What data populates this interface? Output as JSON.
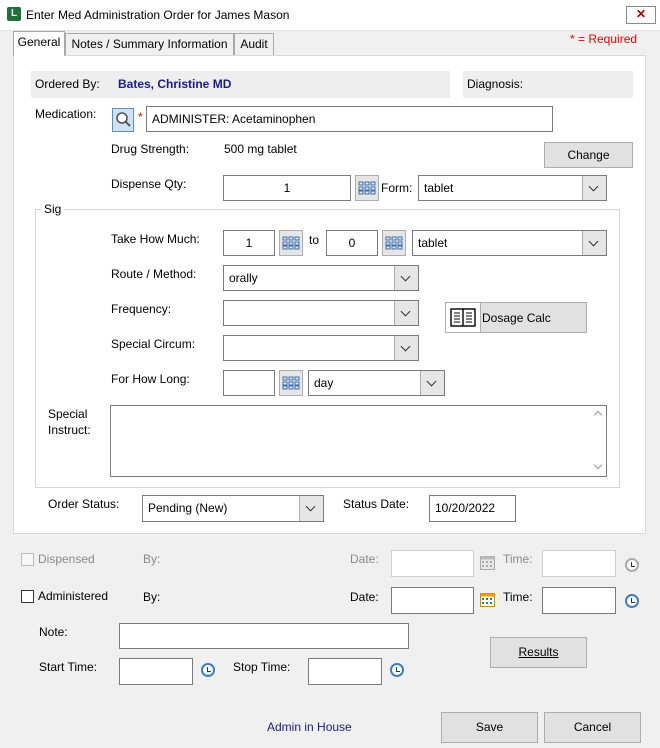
{
  "window": {
    "title": "Enter Med Administration Order for James Mason",
    "icon_letter": "L"
  },
  "tabs": [
    "General",
    "Notes / Summary Information",
    "Audit"
  ],
  "required_note": "* = Required",
  "header": {
    "ordered_by_label": "Ordered By:",
    "ordered_by_value": "Bates, Christine  MD",
    "diagnosis_label": "Diagnosis:"
  },
  "medication": {
    "label": "Medication:",
    "required_mark": "*",
    "value": "ADMINISTER: Acetaminophen",
    "strength_label": "Drug Strength:",
    "strength_value": "500 mg tablet",
    "change_button": "Change",
    "dispense_label": "Dispense Qty:",
    "dispense_value": "1",
    "form_label": "Form:",
    "form_value": "tablet"
  },
  "sig": {
    "group_label": "Sig",
    "take_label": "Take How Much:",
    "take_from": "1",
    "to_label": "to",
    "take_to": "0",
    "take_unit": "tablet",
    "route_label": "Route / Method:",
    "route_value": "orally",
    "frequency_label": "Frequency:",
    "frequency_value": "",
    "dosage_calc_button": "Dosage Calc",
    "special_circum_label": "Special Circum:",
    "special_circum_value": "",
    "how_long_label": "For How Long:",
    "how_long_value": "",
    "how_long_unit": "day",
    "special_instruct_label_1": "Special",
    "special_instruct_label_2": "Instruct:",
    "special_instruct_value": ""
  },
  "status": {
    "order_status_label": "Order Status:",
    "order_status_value": "Pending (New)",
    "status_date_label": "Status Date:",
    "status_date_value": "10/20/2022"
  },
  "dispensed": {
    "label": "Dispensed",
    "checked": false,
    "by_label": "By:",
    "date_label": "Date:",
    "time_label": "Time:"
  },
  "administered": {
    "label": "Administered",
    "checked": false,
    "by_label": "By:",
    "date_label": "Date:",
    "time_label": "Time:"
  },
  "note_label": "Note:",
  "start_time_label": "Start Time:",
  "stop_time_label": "Stop Time:",
  "results_button": "Results",
  "admin_link": "Admin in House",
  "save_button": "Save",
  "cancel_button": "Cancel"
}
